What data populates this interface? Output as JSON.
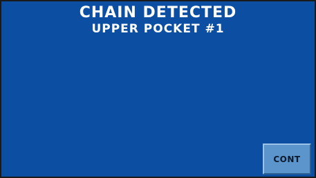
{
  "screen": {
    "title": "CHAIN DETECTED",
    "subtitle": "UPPER POCKET #1"
  },
  "actions": {
    "continue_label": "CONT"
  },
  "colors": {
    "background": "#0b4ea2",
    "button": "#5b95cc",
    "text": "#ffffff"
  }
}
